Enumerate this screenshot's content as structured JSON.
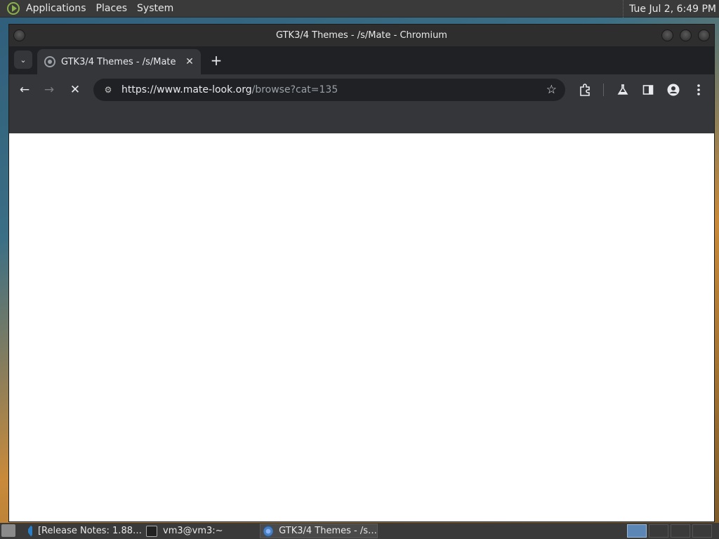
{
  "top_panel": {
    "menus": [
      "Applications",
      "Places",
      "System"
    ],
    "clock": "Tue Jul  2,  6:49 PM"
  },
  "window": {
    "title": "GTK3/4 Themes - /s/Mate - Chromium"
  },
  "tabs": [
    {
      "title": "GTK3/4 Themes - /s/Mate",
      "close": "✕"
    }
  ],
  "toolbar": {
    "back": "←",
    "forward": "→",
    "stop": "✕",
    "new_tab": "+",
    "tab_search": "⌄",
    "url_host": "https://www.mate-look.org",
    "url_path": "/browse?cat=135",
    "bookmark_star": "☆"
  },
  "taskbar": {
    "tasks": [
      {
        "label": "[Release Notes: 1.88…",
        "icon": "vscode-icon"
      },
      {
        "label": "vm3@vm3:~",
        "icon": "terminal-icon"
      },
      {
        "label": "GTK3/4 Themes - /s…",
        "icon": "chromium-icon",
        "active": true
      }
    ]
  },
  "colors": {
    "panel": "#3a3a3a",
    "browser_frame": "#35363a",
    "tabstrip": "#202124",
    "page": "#ffffff"
  }
}
